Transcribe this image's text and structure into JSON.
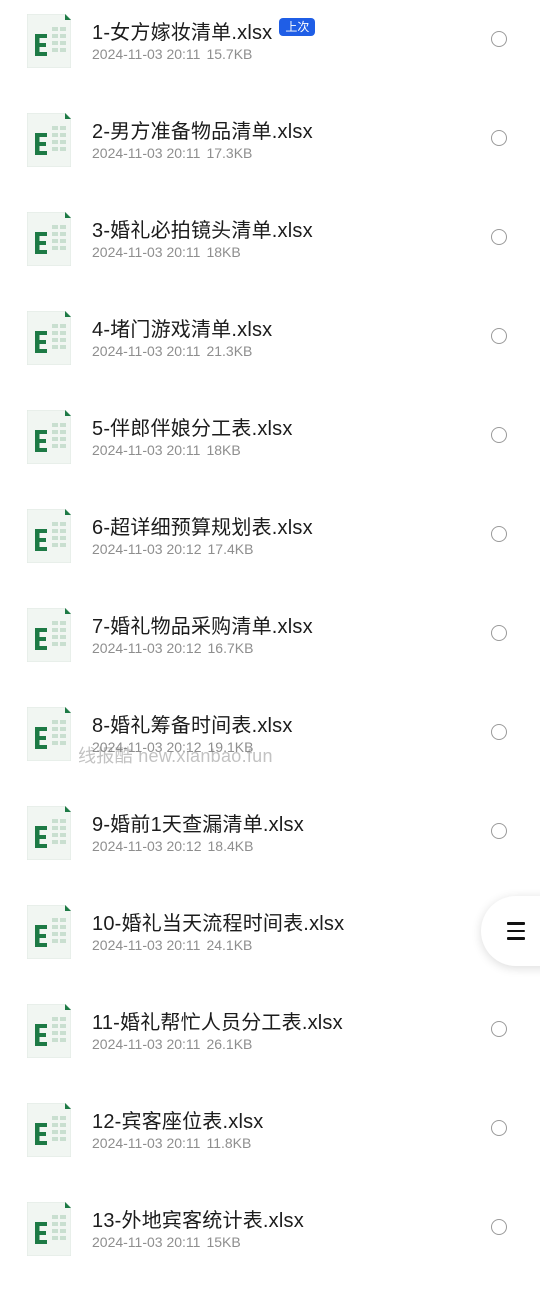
{
  "watermark": "线报酷 new.xianbao.fun",
  "badge_label": "上次",
  "icon_name": "excel-file-icon",
  "colors": {
    "excel_green": "#1d7a45",
    "badge_blue": "#1f5ee6"
  },
  "files": [
    {
      "name": "1-女方嫁妆清单.xlsx",
      "date": "2024-11-03 20:11",
      "size": "15.7KB",
      "recent": true
    },
    {
      "name": "2-男方准备物品清单.xlsx",
      "date": "2024-11-03 20:11",
      "size": "17.3KB"
    },
    {
      "name": "3-婚礼必拍镜头清单.xlsx",
      "date": "2024-11-03 20:11",
      "size": "18KB"
    },
    {
      "name": "4-堵门游戏清单.xlsx",
      "date": "2024-11-03 20:11",
      "size": "21.3KB"
    },
    {
      "name": "5-伴郎伴娘分工表.xlsx",
      "date": "2024-11-03 20:11",
      "size": "18KB"
    },
    {
      "name": "6-超详细预算规划表.xlsx",
      "date": "2024-11-03 20:12",
      "size": "17.4KB"
    },
    {
      "name": "7-婚礼物品采购清单.xlsx",
      "date": "2024-11-03 20:12",
      "size": "16.7KB"
    },
    {
      "name": "8-婚礼筹备时间表.xlsx",
      "date": "2024-11-03 20:12",
      "size": "19.1KB"
    },
    {
      "name": "9-婚前1天查漏清单.xlsx",
      "date": "2024-11-03 20:12",
      "size": "18.4KB"
    },
    {
      "name": "10-婚礼当天流程时间表.xlsx",
      "date": "2024-11-03 20:11",
      "size": "24.1KB",
      "no_radio": true
    },
    {
      "name": "11-婚礼帮忙人员分工表.xlsx",
      "date": "2024-11-03 20:11",
      "size": "26.1KB"
    },
    {
      "name": "12-宾客座位表.xlsx",
      "date": "2024-11-03 20:11",
      "size": "11.8KB"
    },
    {
      "name": "13-外地宾客统计表.xlsx",
      "date": "2024-11-03 20:11",
      "size": "15KB"
    }
  ]
}
